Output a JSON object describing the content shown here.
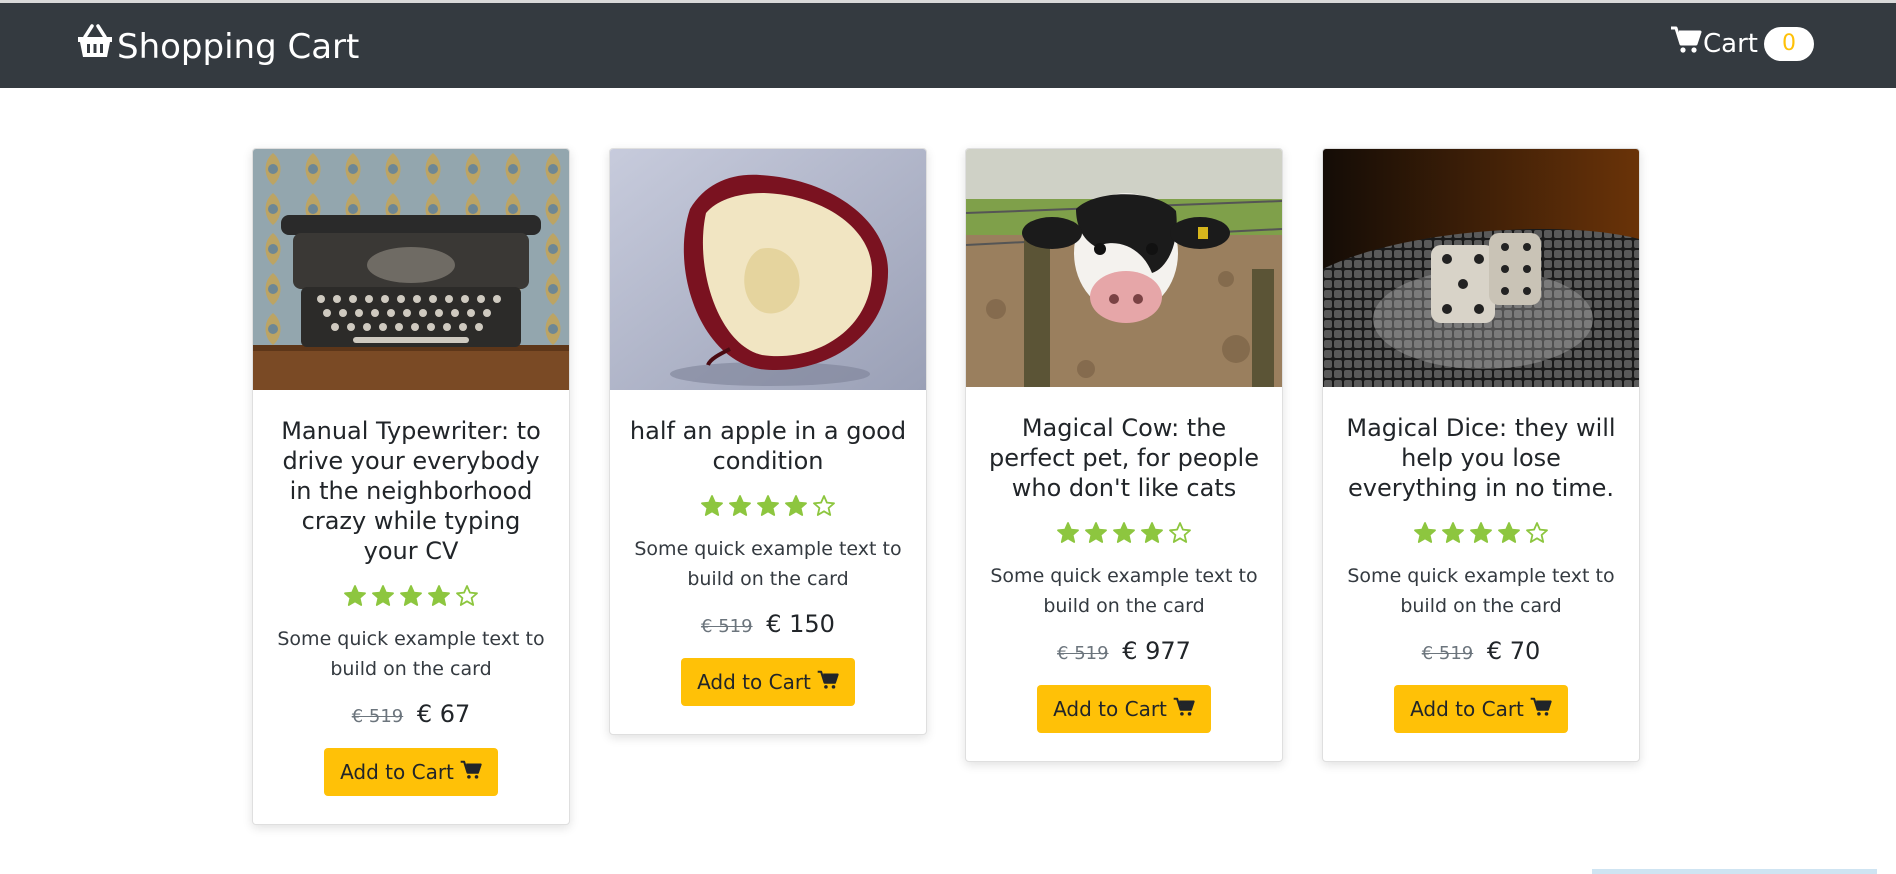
{
  "navbar": {
    "brand_label": "Shopping Cart",
    "brand_icon": "basket-icon",
    "cart_label": "Cart",
    "cart_icon": "cart-icon",
    "cart_count": "0"
  },
  "colors": {
    "navbar_bg": "#343a40",
    "accent": "#ffc107",
    "star": "#8dc63f"
  },
  "products": [
    {
      "title": "Manual Typewriter: to drive your everybody in the neighborhood crazy while typing your CV",
      "rating": 4,
      "rating_max": 5,
      "description": "Some quick example text to build on the card",
      "old_price": "€ 519",
      "price": "€ 67",
      "button_label": "Add to Cart",
      "image": "typewriter-image"
    },
    {
      "title": "half an apple in a good condition",
      "rating": 4,
      "rating_max": 5,
      "description": "Some quick example text to build on the card",
      "old_price": "€ 519",
      "price": "€ 150",
      "button_label": "Add to Cart",
      "image": "apple-image"
    },
    {
      "title": "Magical Cow: the perfect pet, for people who don't like cats",
      "rating": 4,
      "rating_max": 5,
      "description": "Some quick example text to build on the card",
      "old_price": "€ 519",
      "price": "€ 977",
      "button_label": "Add to Cart",
      "image": "cow-image"
    },
    {
      "title": "Magical Dice: they will help you lose everything in no time.",
      "rating": 4,
      "rating_max": 5,
      "description": "Some quick example text to build on the card",
      "old_price": "€ 519",
      "price": "€ 70",
      "button_label": "Add to Cart",
      "image": "dice-image"
    }
  ]
}
